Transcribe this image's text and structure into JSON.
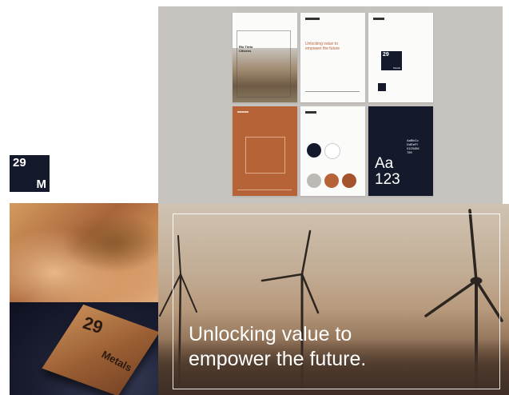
{
  "logo": {
    "number": "29",
    "letter": "M"
  },
  "pages": {
    "cover_title": "Rio Tinto\nCitizens",
    "orange_title": "Unlocking value to\nempower the future",
    "page3_logo_num": "29",
    "page3_logo_word": "Metals",
    "type_big_1": "Aa",
    "type_big_2": "123",
    "type_small": "AaBbCc\nDdEeFf\n0123456\n789"
  },
  "plate": {
    "number": "29",
    "word": "Metals"
  },
  "hero": {
    "line1": "Unlocking value to",
    "line2": "empower the future."
  },
  "colors": {
    "navy": "#141a2c",
    "copper": "#b76338",
    "grey_panel": "#c6c3bf",
    "swatch_grey": "#bdbab6"
  }
}
